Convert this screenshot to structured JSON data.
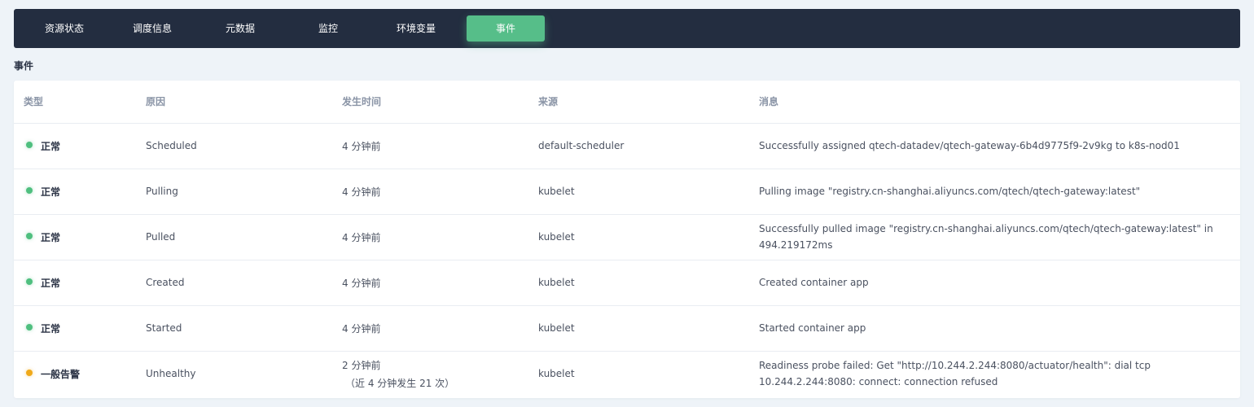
{
  "tabs": [
    {
      "label": "资源状态",
      "active": false
    },
    {
      "label": "调度信息",
      "active": false
    },
    {
      "label": "元数据",
      "active": false
    },
    {
      "label": "监控",
      "active": false
    },
    {
      "label": "环境变量",
      "active": false
    },
    {
      "label": "事件",
      "active": true
    }
  ],
  "colors": {
    "tabbar_bg": "#232d40",
    "accent": "#56be89",
    "status_normal": "#4fbf7f",
    "status_warning": "#f0a91a"
  },
  "section_title": "事件",
  "table": {
    "columns": [
      "类型",
      "原因",
      "发生时间",
      "来源",
      "消息"
    ],
    "rows": [
      {
        "status": "normal",
        "type": "正常",
        "reason": "Scheduled",
        "time": "4 分钟前",
        "time_sub": "",
        "source": "default-scheduler",
        "message": "Successfully assigned qtech-datadev/qtech-gateway-6b4d9775f9-2v9kg to k8s-nod01"
      },
      {
        "status": "normal",
        "type": "正常",
        "reason": "Pulling",
        "time": "4 分钟前",
        "time_sub": "",
        "source": "kubelet",
        "message": "Pulling image \"registry.cn-shanghai.aliyuncs.com/qtech/qtech-gateway:latest\""
      },
      {
        "status": "normal",
        "type": "正常",
        "reason": "Pulled",
        "time": "4 分钟前",
        "time_sub": "",
        "source": "kubelet",
        "message": "Successfully pulled image \"registry.cn-shanghai.aliyuncs.com/qtech/qtech-gateway:latest\" in 494.219172ms"
      },
      {
        "status": "normal",
        "type": "正常",
        "reason": "Created",
        "time": "4 分钟前",
        "time_sub": "",
        "source": "kubelet",
        "message": "Created container app"
      },
      {
        "status": "normal",
        "type": "正常",
        "reason": "Started",
        "time": "4 分钟前",
        "time_sub": "",
        "source": "kubelet",
        "message": "Started container app"
      },
      {
        "status": "warning",
        "type": "一般告警",
        "reason": "Unhealthy",
        "time": "2 分钟前",
        "time_sub": "（近 4 分钟发生 21 次）",
        "source": "kubelet",
        "message": "Readiness probe failed: Get \"http://10.244.2.244:8080/actuator/health\": dial tcp 10.244.2.244:8080: connect: connection refused"
      }
    ]
  }
}
